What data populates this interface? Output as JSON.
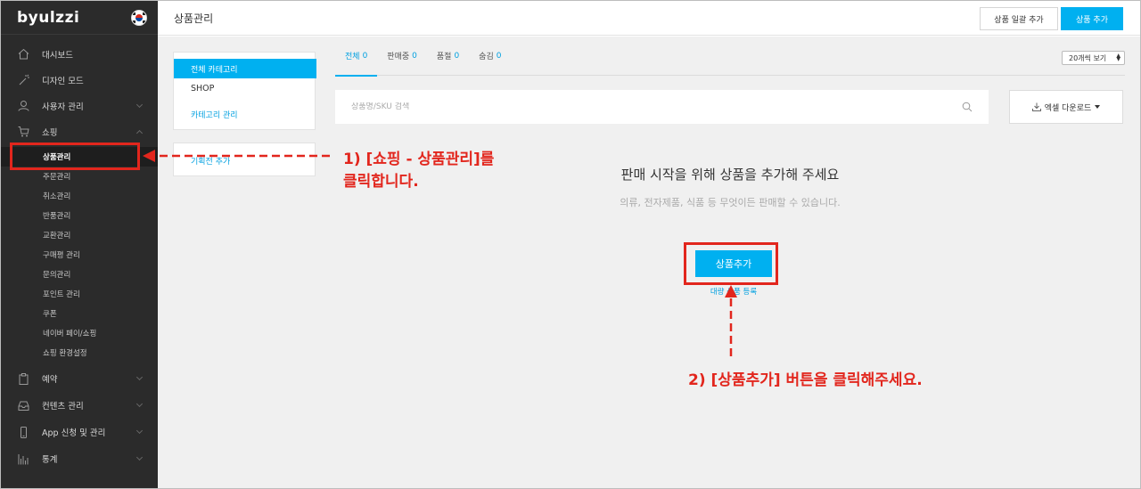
{
  "sidebar": {
    "logo": "byulzzi",
    "menu": [
      {
        "label": "대시보드",
        "icon": "home-icon"
      },
      {
        "label": "디자인 모드",
        "icon": "wand-icon"
      },
      {
        "label": "사용자 관리",
        "icon": "user-icon"
      },
      {
        "label": "쇼핑",
        "icon": "cart-icon"
      }
    ],
    "shopping_sub": [
      "상품관리",
      "주문관리",
      "취소관리",
      "반품관리",
      "교환관리",
      "구매평 관리",
      "문의관리",
      "포인트 관리",
      "쿠폰",
      "네이버 페이/쇼핑",
      "쇼핑 환경설정"
    ],
    "menu_bottom": [
      {
        "label": "예약",
        "icon": "clipboard-icon"
      },
      {
        "label": "컨텐츠 관리",
        "icon": "inbox-icon"
      },
      {
        "label": "App 신청 및 관리",
        "icon": "phone-icon"
      },
      {
        "label": "통계",
        "icon": "bar-chart-icon"
      }
    ]
  },
  "header": {
    "title": "상품관리",
    "bulk_add_label": "상품 일괄 추가",
    "add_label": "상품 추가"
  },
  "categories": {
    "all": "전체 카테고리",
    "shop": "SHOP",
    "manage": "카테고리 관리",
    "plan_add": "기획전 추가"
  },
  "tabs": [
    {
      "label": "전체",
      "count": "0"
    },
    {
      "label": "판매중",
      "count": "0"
    },
    {
      "label": "품절",
      "count": "0"
    },
    {
      "label": "숨김",
      "count": "0"
    }
  ],
  "view_select": "20개씩 보기",
  "search": {
    "placeholder": "상품명/SKU 검색"
  },
  "excel_label": "엑셀 다운로드",
  "empty": {
    "title": "판매 시작을 위해 상품을 추가해 주세요",
    "subtitle": "의류, 전자제품, 식품 등 무엇이든 판매할 수 있습니다.",
    "add_button": "상품추가",
    "bulk_link": "대량 상품 등록"
  },
  "annotations": {
    "step1_line1": "1) [쇼핑 - 상품관리]를",
    "step1_line2": "클릭합니다.",
    "step2": "2) [상품추가] 버튼을 클릭해주세요.",
    "color": "#e2261d"
  },
  "colors": {
    "accent": "#00b0f0",
    "sidebar_bg": "#2b2b2b"
  }
}
